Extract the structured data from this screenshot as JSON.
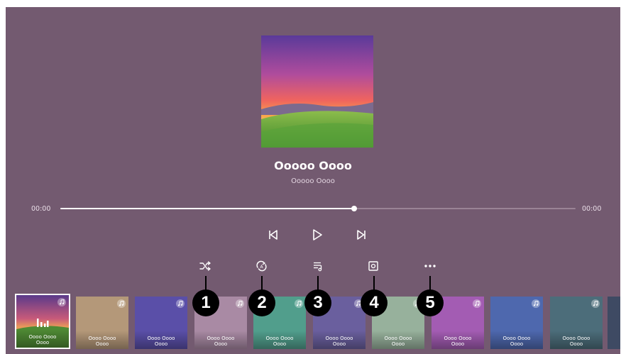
{
  "player": {
    "title": "Ooooo Oooo",
    "artist": "Ooooo Oooo",
    "time_elapsed": "00:00",
    "time_total": "00:00",
    "progress_fraction": 0.57
  },
  "transport": {
    "icons": [
      "skip-previous-icon",
      "play-icon",
      "skip-next-icon"
    ]
  },
  "options": {
    "icons": [
      "shuffle-icon",
      "repeat-icon",
      "playlist-icon",
      "screen-off-icon",
      "more-icon"
    ]
  },
  "callouts": [
    "1",
    "2",
    "3",
    "4",
    "5"
  ],
  "playlist": [
    {
      "label": "Oooo Oooo Oooo",
      "color": "#5a7a55",
      "playing": true
    },
    {
      "label": "Oooo Oooo Oooo",
      "color": "#b49879"
    },
    {
      "label": "Oooo Oooo Oooo",
      "color": "#5a4fa8"
    },
    {
      "label": "Oooo Oooo Oooo",
      "color": "#a98aa4"
    },
    {
      "label": "Oooo Oooo Oooo",
      "color": "#519e8c"
    },
    {
      "label": "Oooo Oooo Oooo",
      "color": "#6a5f9e"
    },
    {
      "label": "Oooo Oooo Oooo",
      "color": "#97b19c"
    },
    {
      "label": "Oooo Oooo Oooo",
      "color": "#a35cb3"
    },
    {
      "label": "Oooo Oooo Oooo",
      "color": "#4e68ae"
    },
    {
      "label": "Oooo Oooo Oooo",
      "color": "#4c6d7a"
    }
  ],
  "colors": {
    "background": "#735a70",
    "progress": "#ffffff",
    "callout": "#000000"
  }
}
